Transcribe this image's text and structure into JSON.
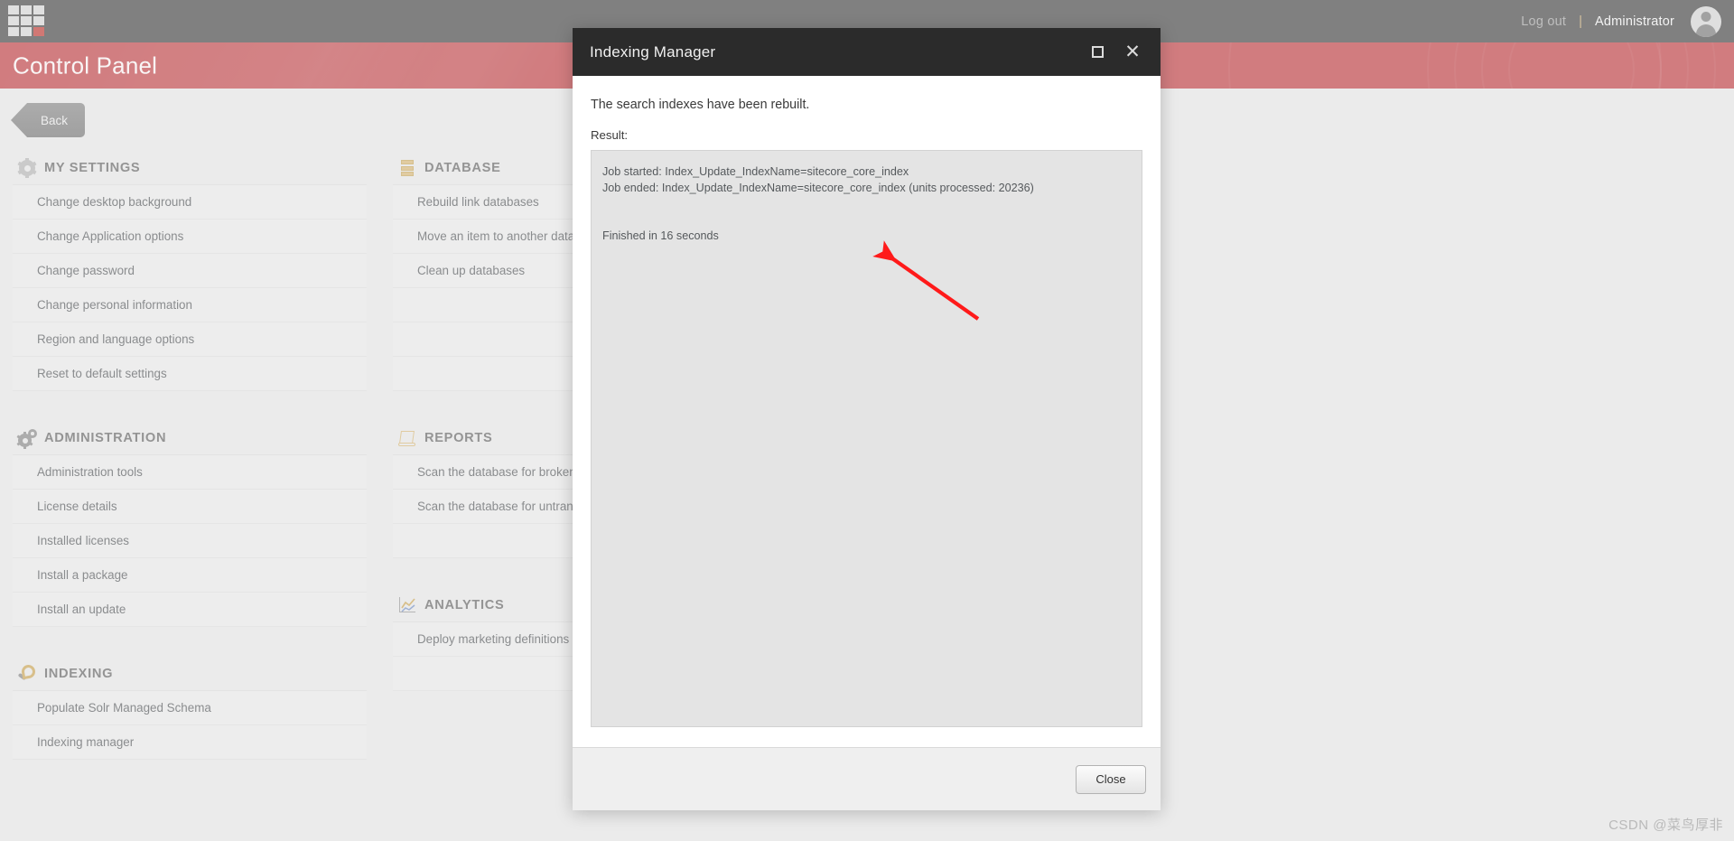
{
  "topbar": {
    "logo_icon": "sitecore-grid-logo",
    "logout_label": "Log out",
    "separator": "|",
    "user_label": "Administrator",
    "avatar_icon": "user-avatar-icon"
  },
  "banner": {
    "title": "Control Panel",
    "color": "#bf4a4e"
  },
  "back_bar": {
    "back_label": "Back"
  },
  "columns": [
    {
      "groups": [
        {
          "title": "MY SETTINGS",
          "icon": "gear-icon",
          "items": [
            "Change desktop background",
            "Change Application options",
            "Change password",
            "Change personal information",
            "Region and language options",
            "Reset to default settings"
          ]
        },
        {
          "title": "ADMINISTRATION",
          "icon": "gears-icon",
          "items": [
            "Administration tools",
            "License details",
            "Installed licenses",
            "Install a package",
            "Install an update"
          ]
        },
        {
          "title": "INDEXING",
          "icon": "indexing-icon",
          "items": [
            "Populate Solr Managed Schema",
            "Indexing manager"
          ]
        }
      ]
    },
    {
      "groups": [
        {
          "title": "DATABASE",
          "icon": "database-icon",
          "items": [
            "Rebuild link databases",
            "Move an item to another database",
            "Clean up databases"
          ]
        },
        {
          "title": "REPORTS",
          "icon": "report-scroll-icon",
          "items": [
            "Scan the database for broken links",
            "Scan the database for untranslated items"
          ]
        },
        {
          "title": "ANALYTICS",
          "icon": "analytics-chart-icon",
          "items": [
            "Deploy marketing definitions"
          ]
        }
      ]
    }
  ],
  "dialog": {
    "title": "Indexing Manager",
    "maximize_icon": "maximize-icon",
    "close_icon": "close-icon",
    "message": "The search indexes have been rebuilt.",
    "result_label": "Result:",
    "result_lines": [
      "Job started: Index_Update_IndexName=sitecore_core_index",
      "Job ended: Index_Update_IndexName=sitecore_core_index (units processed: 20236)"
    ],
    "finished_line": "Finished in 16 seconds",
    "close_button_label": "Close"
  },
  "annotation": {
    "arrow_color": "#ff1a1a",
    "icon": "red-arrow-annotation"
  },
  "watermark": "CSDN @菜鸟厚非"
}
